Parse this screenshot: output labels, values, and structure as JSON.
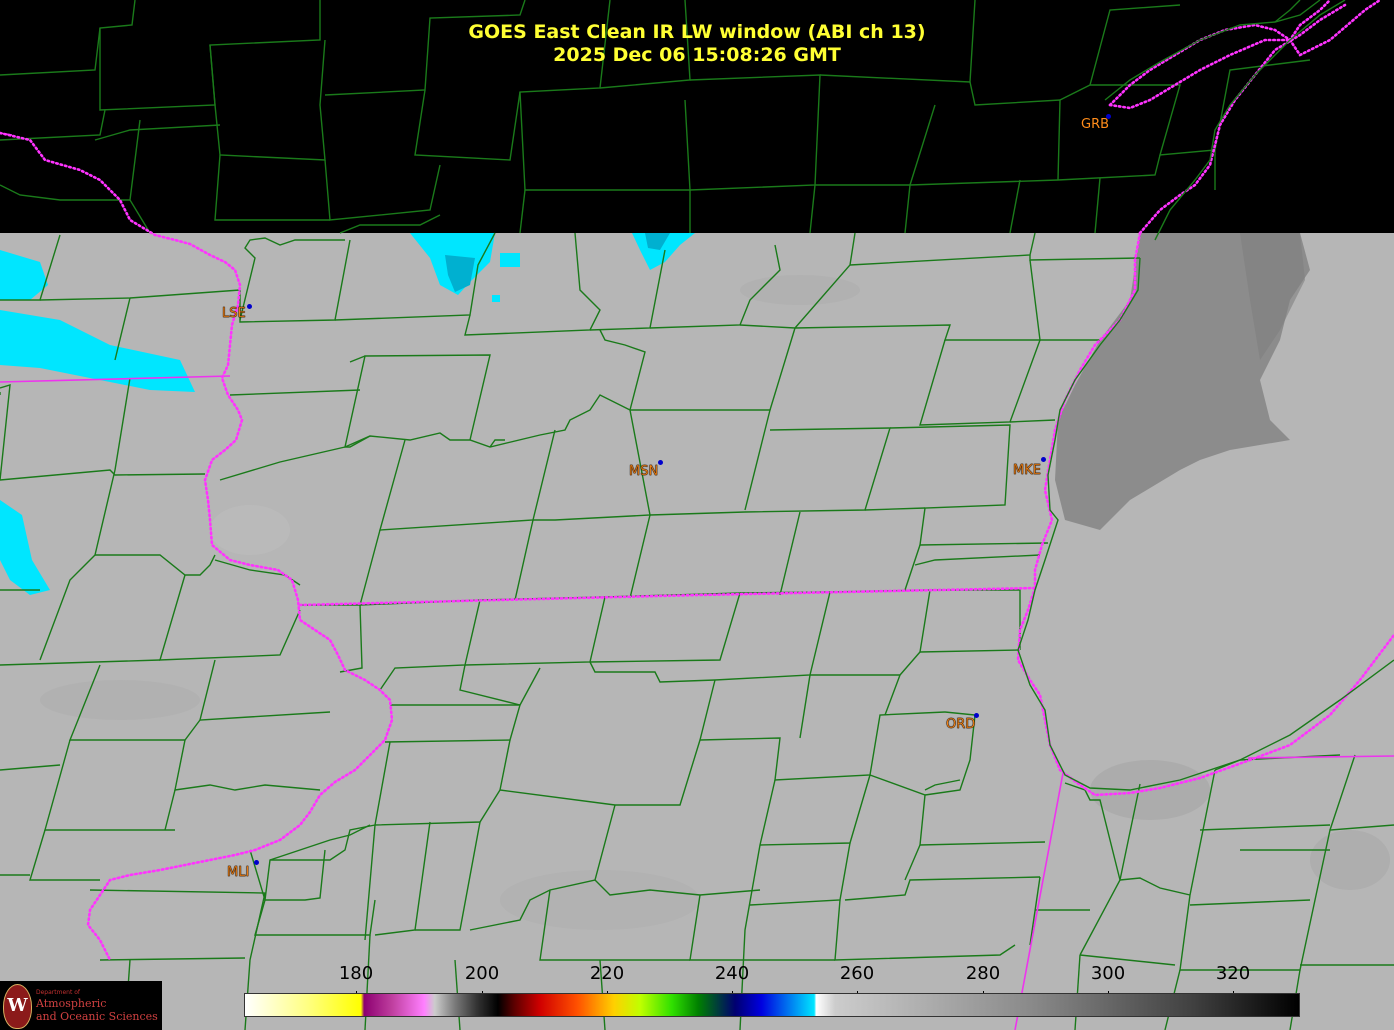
{
  "title": {
    "line1": "GOES East Clean IR LW window (ABI ch 13)",
    "line2": "2025 Dec 06  15:08:26 GMT"
  },
  "stations": [
    {
      "id": "GRB",
      "style": "plain"
    },
    {
      "id": "LSE",
      "style": "outlined"
    },
    {
      "id": "MSN",
      "style": "outlined"
    },
    {
      "id": "MKE",
      "style": "outlined"
    },
    {
      "id": "ORD",
      "style": "outlined"
    },
    {
      "id": "MLI",
      "style": "outlined"
    }
  ],
  "colorbar": {
    "unit_hint": "brightness temperature (K)",
    "ticks": [
      "180",
      "200",
      "220",
      "240",
      "260",
      "280",
      "300",
      "320"
    ]
  },
  "logo": {
    "shield_letter": "W",
    "line1": "Department of",
    "line2": "Atmospheric",
    "line3": "and Oceanic Sciences"
  },
  "colors": {
    "title": "#ffff33",
    "county_lines": "#1a7a1a",
    "state_lines": "#ff33ff",
    "station_label": "#ff8c1a",
    "station_dot": "#0000cc",
    "cold_cloud": "#00e6ff",
    "ground": "#b4b4b4",
    "lake": "#8c8c8c"
  }
}
